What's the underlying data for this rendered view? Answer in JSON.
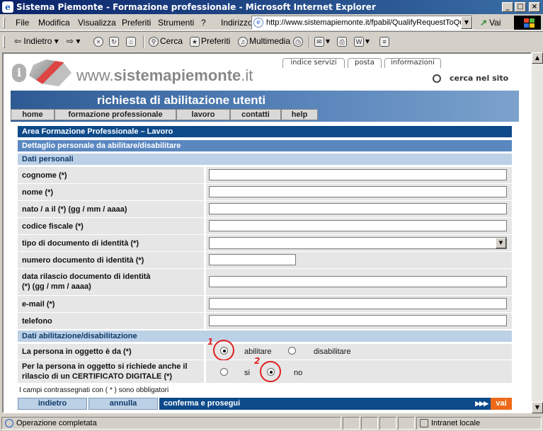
{
  "window": {
    "title": "Sistema Piemonte - Formazione professionale - Microsoft Internet Explorer",
    "controls": {
      "minimize": "_",
      "maximize": "□",
      "close": "×"
    }
  },
  "menu": {
    "items": [
      "File",
      "Modifica",
      "Visualizza",
      "Preferiti",
      "Strumenti",
      "?"
    ],
    "address_label": "Indirizzo",
    "url": "http://www.sistemapiemonte.it/fpabil/QualifyRequestToQu",
    "go_label": "Vai"
  },
  "toolbar": {
    "back": "Indietro",
    "search": "Cerca",
    "favorites": "Preferiti",
    "multimedia": "Multimedia"
  },
  "site": {
    "logo_prefix": "www.",
    "logo_name": "sistemapiemonte",
    "logo_suffix": ".it",
    "top_tabs": [
      "indice servizi",
      "posta",
      "informazioni"
    ],
    "search_label": "cerca nel sito",
    "banner_title": "richiesta di abilitazione utenti",
    "nav": [
      "home",
      "formazione professionale",
      "lavoro",
      "contatti",
      "help"
    ]
  },
  "form": {
    "area_title": "Area Formazione Professionale – Lavoro",
    "detail_title": "Dettaglio personale da abilitare/disabilitare",
    "personal_section": "Dati personali",
    "fields": {
      "cognome": {
        "label": "cognome (*)",
        "value": ""
      },
      "nome": {
        "label": "nome (*)",
        "value": ""
      },
      "nato": {
        "label": "nato / a il (*) (gg / mm / aaaa)",
        "value": ""
      },
      "codice_fiscale": {
        "label": "codice fiscale (*)",
        "value": ""
      },
      "tipo_documento": {
        "label": "tipo di documento di identità (*)",
        "value": ""
      },
      "numero_documento": {
        "label": "numero documento di identità (*)",
        "value": ""
      },
      "data_rilascio": {
        "label_line1": "data rilascio documento di identità",
        "label_line2": "(*) (gg / mm / aaaa)",
        "value": ""
      },
      "email": {
        "label": "e-mail (*)",
        "value": ""
      },
      "telefono": {
        "label": "telefono",
        "value": ""
      }
    },
    "abilitazione_section": "Dati abilitazione/disabilitazione",
    "persona": {
      "label": "La persona in oggetto è da (*)",
      "options": [
        "abilitare",
        "disabilitare"
      ],
      "selected": "abilitare"
    },
    "certificato": {
      "label_line1": "Per la persona in oggetto si richiede anche il",
      "label_line2": "rilascio di un CERTIFICATO DIGITALE (*)",
      "options": [
        "si",
        "no"
      ],
      "selected": "no"
    },
    "annotations": [
      "1",
      "2"
    ],
    "required_note": "I campi contrassegnati con ( * ) sono obbligatori",
    "buttons": {
      "back": "indietro",
      "cancel": "annulla",
      "confirm": "conferma e prosegui",
      "arrows": "▶▶▶",
      "go": "vai"
    }
  },
  "status": {
    "left": "Operazione completata",
    "zone": "Intranet locale"
  }
}
